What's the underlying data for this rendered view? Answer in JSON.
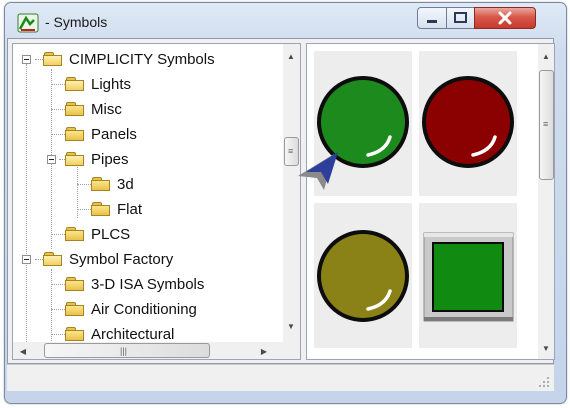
{
  "window": {
    "title": "- Symbols",
    "app_icon": "symbols-app-icon"
  },
  "caption_buttons": {
    "minimize": "minimize-icon",
    "maximize": "maximize-icon",
    "close": "close-icon"
  },
  "tree": {
    "items": [
      {
        "label": "CIMPLICITY Symbols",
        "level": 0,
        "expanded": true
      },
      {
        "label": "Lights",
        "level": 1,
        "selected_folder": true
      },
      {
        "label": "Misc",
        "level": 1
      },
      {
        "label": "Panels",
        "level": 1
      },
      {
        "label": "Pipes",
        "level": 1,
        "expanded": true
      },
      {
        "label": "3d",
        "level": 2
      },
      {
        "label": "Flat",
        "level": 2
      },
      {
        "label": "PLCS",
        "level": 1
      },
      {
        "label": "Symbol Factory",
        "level": 0,
        "expanded": true
      },
      {
        "label": "3-D ISA Symbols",
        "level": 1
      },
      {
        "label": "Air Conditioning",
        "level": 1
      },
      {
        "label": "Architectural",
        "level": 1
      }
    ],
    "hscroll_grip": "|||",
    "vscroll_grip": "≡"
  },
  "symbols": [
    {
      "name": "green-light",
      "color": "#1c8a1c"
    },
    {
      "name": "red-light",
      "color": "#8b0000"
    },
    {
      "name": "olive-light",
      "color": "#8a8216"
    },
    {
      "name": "green-square-button",
      "color": "#118a11"
    }
  ],
  "symbols_vscroll_grip": "≡",
  "colors": {
    "accent_cursor": "#2d3f9a"
  }
}
